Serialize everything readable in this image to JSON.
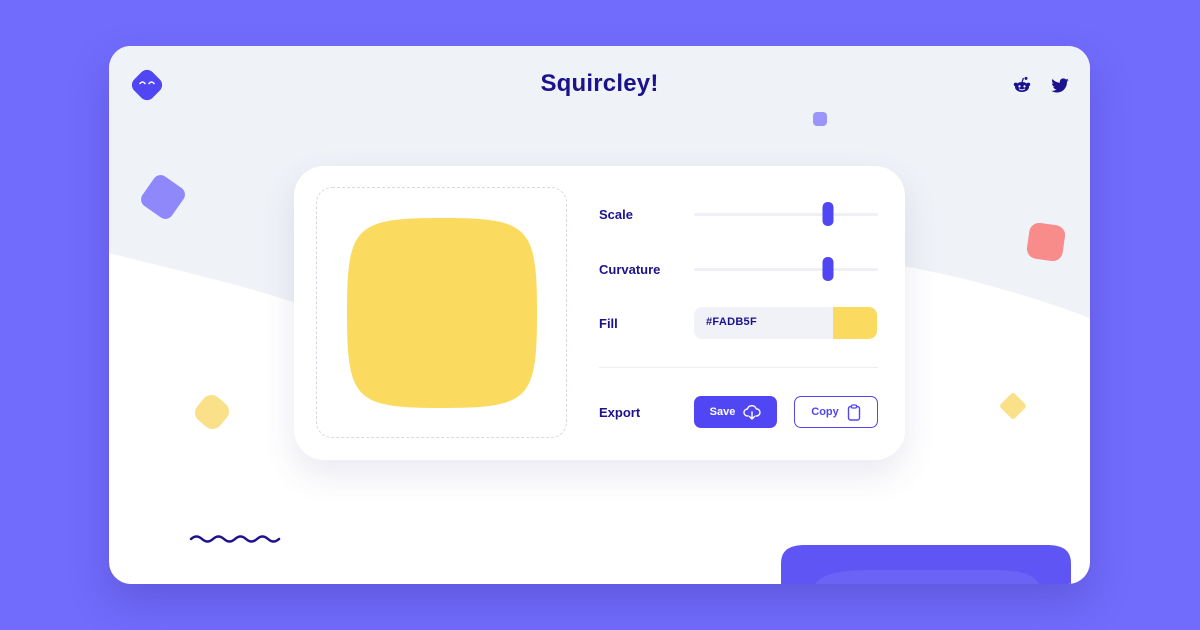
{
  "app": {
    "title": "Squircley!"
  },
  "header": {
    "logo_icon": "squircle-face-logo-icon",
    "social": [
      {
        "name": "reddit",
        "icon": "reddit-icon"
      },
      {
        "name": "twitter",
        "icon": "twitter-icon"
      }
    ]
  },
  "controls": {
    "scale": {
      "label": "Scale",
      "value_percent": 73
    },
    "curvature": {
      "label": "Curvature",
      "value_percent": 73
    },
    "fill": {
      "label": "Fill",
      "value": "#FADB5F"
    },
    "export": {
      "label": "Export",
      "save_label": "Save",
      "save_icon": "cloud-download-icon",
      "copy_label": "Copy",
      "copy_icon": "clipboard-icon"
    }
  },
  "colors": {
    "background": "#726cfc",
    "accent": "#5146f4",
    "text": "#1c128c",
    "squircle_fill": "#FADB5F",
    "coral": "#f78c8a"
  }
}
